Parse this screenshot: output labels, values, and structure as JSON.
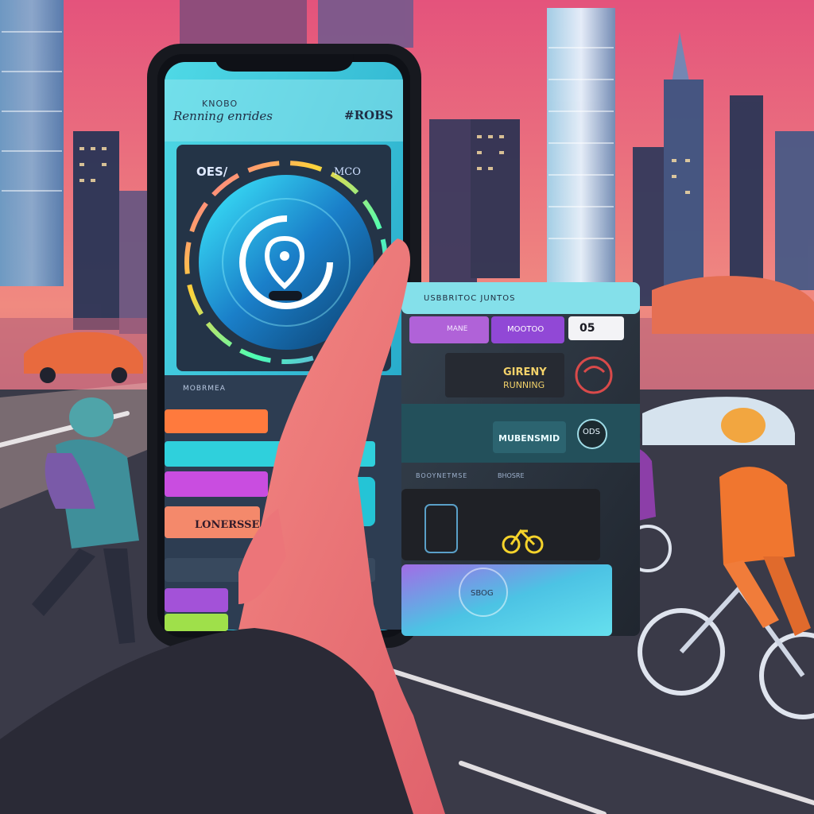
{
  "phone": {
    "header_small": "KNOBO",
    "header_title": "Renning enrides",
    "header_code": "#ROBS",
    "gauge_reading": "OES/",
    "gauge_unit": "MCO",
    "section_label": "MOBRMEA",
    "menu": [
      "",
      "",
      "",
      "LONERSSE",
      ""
    ]
  },
  "panel": {
    "title": "USBBRITOC JUNTOS",
    "tab1": "MANE",
    "tab2": "MOOTOO",
    "badge": "05",
    "card_title": "GIRENY",
    "card_sub": "RUNNING",
    "card2_label": "MUBENSMID",
    "card2_chip": "ODS",
    "row_label": "BOOYNETMSE",
    "row_value": "BHOSRE",
    "bottom_label": "SBOG"
  },
  "colors": {
    "sky_top": "#e8557a",
    "sky_bottom": "#f3a07e",
    "screen_teal": "#2ec7d8",
    "accent_purple": "#b454e0",
    "accent_orange": "#ff7a3d",
    "road": "#3a3a48",
    "skin": "#f07d7d"
  },
  "icons": [
    "location-pin-icon",
    "bicycle-icon",
    "face-icon"
  ]
}
